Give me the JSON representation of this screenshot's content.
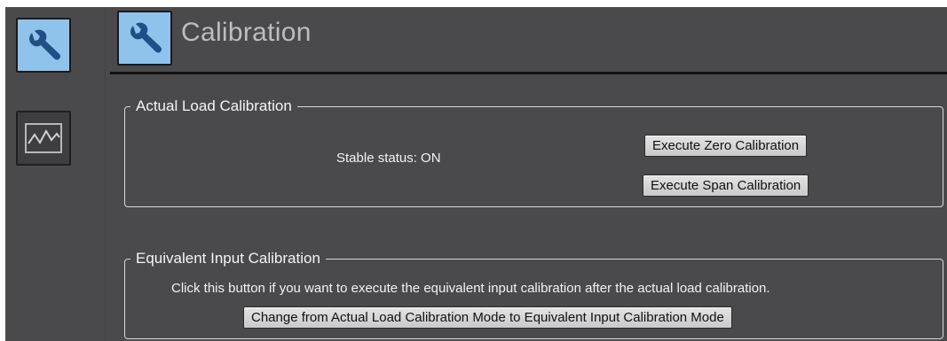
{
  "left_rail": {
    "items": [
      {
        "icon": "wrench-icon",
        "state": "active"
      },
      {
        "icon": "waveform-icon",
        "state": "inactive"
      }
    ]
  },
  "header": {
    "icon": "wrench-icon",
    "title": "Calibration"
  },
  "actual_load": {
    "legend": "Actual Load Calibration",
    "status": "Stable status: ON",
    "zero_button": "Execute Zero Calibration",
    "span_button": "Execute Span Calibration"
  },
  "equivalent_input": {
    "legend": "Equivalent Input Calibration",
    "instruction": "Click this button if you want to execute the equivalent input calibration after the actual load calibration.",
    "mode_button": "Change from Actual Load Calibration Mode to Equivalent Input Calibration Mode"
  },
  "colors": {
    "background": "#4a4a4c",
    "accent": "#8fc3ec",
    "title_text": "#bdbdbd"
  }
}
